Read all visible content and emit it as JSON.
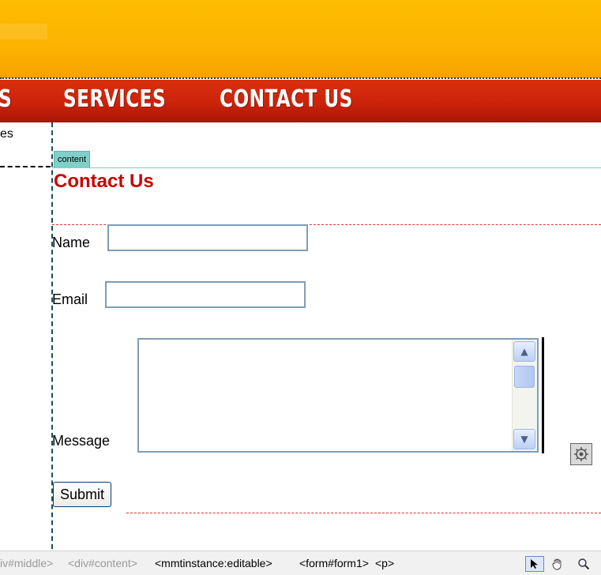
{
  "nav": {
    "items": [
      "S",
      "SERVICES",
      "CONTACT US"
    ]
  },
  "left_column": {
    "text": "es"
  },
  "content": {
    "region_tab": "content",
    "title": "Contact Us"
  },
  "form": {
    "name_label": "Name",
    "name_value": "",
    "email_label": "Email",
    "email_value": "",
    "message_label": "Message",
    "message_value": "",
    "submit_label": "Submit"
  },
  "status_bar": {
    "crumbs_dim": [
      "iv#middle>",
      "<div#content>"
    ],
    "crumbs": [
      "<mmtinstance:editable>",
      "<form#form1>",
      "<p>"
    ],
    "tools": [
      "pointer-icon",
      "hand-icon",
      "zoom-icon"
    ]
  },
  "colors": {
    "header_yellow": "#fcb300",
    "nav_red": "#cc230a",
    "title_red": "#cc0000",
    "region_tab": "#7ed0c8"
  }
}
